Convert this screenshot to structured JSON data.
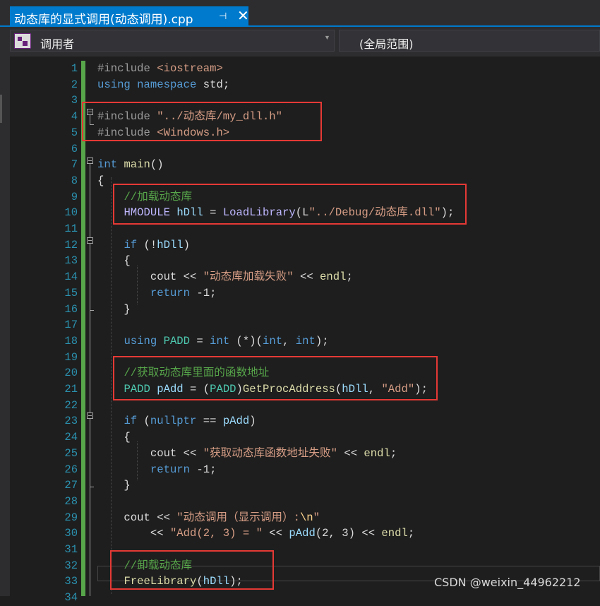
{
  "tab": {
    "title": "动态库的显式调用(动态调用).cpp",
    "pin_icon": "pin-icon",
    "close_icon": "close-icon",
    "close_glyph": "✕",
    "pin_glyph": "⊣"
  },
  "navigation": {
    "scope_label": "调用者",
    "member_label": "(全局范围)",
    "dropdown_glyph": "▼"
  },
  "colors": {
    "accent": "#007acc",
    "keyword": "#569cd6",
    "comment": "#57a64a",
    "string": "#d69d85",
    "function": "#dcdcaa",
    "line_number": "#2b91af",
    "highlight_box": "#e53935"
  },
  "code": {
    "line_numbers": [
      "1",
      "2",
      "3",
      "4",
      "5",
      "6",
      "7",
      "8",
      "9",
      "10",
      "11",
      "12",
      "13",
      "14",
      "15",
      "16",
      "17",
      "18",
      "19",
      "20",
      "21",
      "22",
      "23",
      "24",
      "25",
      "26",
      "27",
      "28",
      "29",
      "30",
      "31",
      "32",
      "33",
      "34"
    ],
    "lines": [
      [
        {
          "t": "#include ",
          "c": "pp"
        },
        {
          "t": "<iostream>",
          "c": "st"
        }
      ],
      [
        {
          "t": "using",
          "c": "kw"
        },
        {
          "t": " ",
          "c": "pl"
        },
        {
          "t": "namespace",
          "c": "kw"
        },
        {
          "t": " std;",
          "c": "pl"
        }
      ],
      [],
      [
        {
          "t": "#include ",
          "c": "pp"
        },
        {
          "t": "\"../动态库/my_dll.h\"",
          "c": "st"
        }
      ],
      [
        {
          "t": "#include ",
          "c": "pp"
        },
        {
          "t": "<Windows.h>",
          "c": "st"
        }
      ],
      [],
      [
        {
          "t": "int",
          "c": "kw"
        },
        {
          "t": " ",
          "c": "pl"
        },
        {
          "t": "main",
          "c": "fn"
        },
        {
          "t": "()",
          "c": "pl"
        }
      ],
      [
        {
          "t": "{",
          "c": "pl"
        }
      ],
      [
        {
          "t": "    ",
          "c": "pl"
        },
        {
          "t": "//加载动态库",
          "c": "cm"
        }
      ],
      [
        {
          "t": "    ",
          "c": "pl"
        },
        {
          "t": "HMODULE",
          "c": "mc"
        },
        {
          "t": " ",
          "c": "pl"
        },
        {
          "t": "hDll",
          "c": "vr"
        },
        {
          "t": " = ",
          "c": "pl"
        },
        {
          "t": "LoadLibrary",
          "c": "mc"
        },
        {
          "t": "(L",
          "c": "pl"
        },
        {
          "t": "\"../Debug/动态库.dll\"",
          "c": "st"
        },
        {
          "t": ");",
          "c": "pl"
        }
      ],
      [],
      [
        {
          "t": "    ",
          "c": "pl"
        },
        {
          "t": "if",
          "c": "kw"
        },
        {
          "t": " (!",
          "c": "pl"
        },
        {
          "t": "hDll",
          "c": "vr"
        },
        {
          "t": ")",
          "c": "pl"
        }
      ],
      [
        {
          "t": "    {",
          "c": "pl"
        }
      ],
      [
        {
          "t": "        cout << ",
          "c": "pl"
        },
        {
          "t": "\"动态库加载失败\"",
          "c": "st"
        },
        {
          "t": " << ",
          "c": "pl"
        },
        {
          "t": "endl",
          "c": "fn"
        },
        {
          "t": ";",
          "c": "pl"
        }
      ],
      [
        {
          "t": "        ",
          "c": "pl"
        },
        {
          "t": "return",
          "c": "kw"
        },
        {
          "t": " -1;",
          "c": "pl"
        }
      ],
      [
        {
          "t": "    }",
          "c": "pl"
        }
      ],
      [],
      [
        {
          "t": "    ",
          "c": "pl"
        },
        {
          "t": "using",
          "c": "kw"
        },
        {
          "t": " ",
          "c": "pl"
        },
        {
          "t": "PADD",
          "c": "ty"
        },
        {
          "t": " = ",
          "c": "pl"
        },
        {
          "t": "int",
          "c": "kw"
        },
        {
          "t": " (*)(",
          "c": "pl"
        },
        {
          "t": "int",
          "c": "kw"
        },
        {
          "t": ", ",
          "c": "pl"
        },
        {
          "t": "int",
          "c": "kw"
        },
        {
          "t": ");",
          "c": "pl"
        }
      ],
      [],
      [
        {
          "t": "    ",
          "c": "pl"
        },
        {
          "t": "//获取动态库里面的函数地址",
          "c": "cm"
        }
      ],
      [
        {
          "t": "    ",
          "c": "pl"
        },
        {
          "t": "PADD",
          "c": "ty"
        },
        {
          "t": " ",
          "c": "pl"
        },
        {
          "t": "pAdd",
          "c": "vr"
        },
        {
          "t": " = (",
          "c": "pl"
        },
        {
          "t": "PADD",
          "c": "ty"
        },
        {
          "t": ")",
          "c": "pl"
        },
        {
          "t": "GetProcAddress",
          "c": "fn"
        },
        {
          "t": "(",
          "c": "pl"
        },
        {
          "t": "hDll",
          "c": "vr"
        },
        {
          "t": ", ",
          "c": "pl"
        },
        {
          "t": "\"Add\"",
          "c": "st"
        },
        {
          "t": ");",
          "c": "pl"
        }
      ],
      [],
      [
        {
          "t": "    ",
          "c": "pl"
        },
        {
          "t": "if",
          "c": "kw"
        },
        {
          "t": " (",
          "c": "pl"
        },
        {
          "t": "nullptr",
          "c": "kw"
        },
        {
          "t": " == ",
          "c": "pl"
        },
        {
          "t": "pAdd",
          "c": "vr"
        },
        {
          "t": ")",
          "c": "pl"
        }
      ],
      [
        {
          "t": "    {",
          "c": "pl"
        }
      ],
      [
        {
          "t": "        cout << ",
          "c": "pl"
        },
        {
          "t": "\"获取动态库函数地址失败\"",
          "c": "st"
        },
        {
          "t": " << ",
          "c": "pl"
        },
        {
          "t": "endl",
          "c": "fn"
        },
        {
          "t": ";",
          "c": "pl"
        }
      ],
      [
        {
          "t": "        ",
          "c": "pl"
        },
        {
          "t": "return",
          "c": "kw"
        },
        {
          "t": " -1;",
          "c": "pl"
        }
      ],
      [
        {
          "t": "    }",
          "c": "pl"
        }
      ],
      [],
      [
        {
          "t": "    cout << ",
          "c": "pl"
        },
        {
          "t": "\"动态调用（显示调用）:",
          "c": "st"
        },
        {
          "t": "\\n",
          "c": "es"
        },
        {
          "t": "\"",
          "c": "st"
        }
      ],
      [
        {
          "t": "        << ",
          "c": "pl"
        },
        {
          "t": "\"Add(2, 3) = \"",
          "c": "st"
        },
        {
          "t": " << ",
          "c": "pl"
        },
        {
          "t": "pAdd",
          "c": "vr"
        },
        {
          "t": "(2, 3) << ",
          "c": "pl"
        },
        {
          "t": "endl",
          "c": "fn"
        },
        {
          "t": ";",
          "c": "pl"
        }
      ],
      [],
      [
        {
          "t": "    ",
          "c": "pl"
        },
        {
          "t": "//卸载动态库",
          "c": "cm"
        }
      ],
      [
        {
          "t": "    ",
          "c": "pl"
        },
        {
          "t": "FreeLibrary",
          "c": "fn"
        },
        {
          "t": "(",
          "c": "pl"
        },
        {
          "t": "hDll",
          "c": "vr"
        },
        {
          "t": ");",
          "c": "pl"
        }
      ],
      []
    ]
  },
  "watermark": "CSDN @weixin_44962212"
}
